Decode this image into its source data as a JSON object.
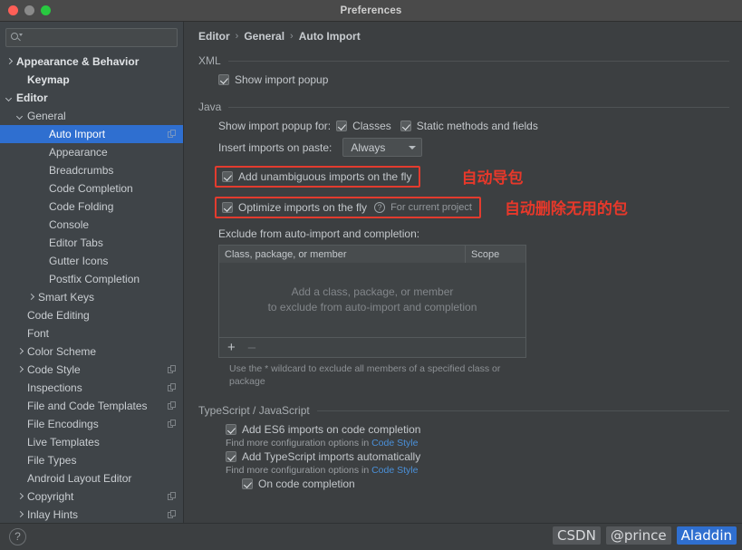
{
  "window": {
    "title": "Preferences",
    "traffic": [
      "close",
      "minimize",
      "zoom"
    ]
  },
  "sidebar": {
    "search": {
      "value": "",
      "placeholder": ""
    },
    "items": [
      {
        "label": "Appearance & Behavior",
        "indent": 0,
        "arrow": "right",
        "bold": true,
        "selected": false,
        "badge": false
      },
      {
        "label": "Keymap",
        "indent": 1,
        "arrow": "none",
        "bold": true,
        "selected": false,
        "badge": false
      },
      {
        "label": "Editor",
        "indent": 0,
        "arrow": "down",
        "bold": true,
        "selected": false,
        "badge": false
      },
      {
        "label": "General",
        "indent": 1,
        "arrow": "down",
        "bold": false,
        "selected": false,
        "badge": false
      },
      {
        "label": "Auto Import",
        "indent": 3,
        "arrow": "none",
        "bold": false,
        "selected": true,
        "badge": true
      },
      {
        "label": "Appearance",
        "indent": 3,
        "arrow": "none",
        "bold": false,
        "selected": false,
        "badge": false
      },
      {
        "label": "Breadcrumbs",
        "indent": 3,
        "arrow": "none",
        "bold": false,
        "selected": false,
        "badge": false
      },
      {
        "label": "Code Completion",
        "indent": 3,
        "arrow": "none",
        "bold": false,
        "selected": false,
        "badge": false
      },
      {
        "label": "Code Folding",
        "indent": 3,
        "arrow": "none",
        "bold": false,
        "selected": false,
        "badge": false
      },
      {
        "label": "Console",
        "indent": 3,
        "arrow": "none",
        "bold": false,
        "selected": false,
        "badge": false
      },
      {
        "label": "Editor Tabs",
        "indent": 3,
        "arrow": "none",
        "bold": false,
        "selected": false,
        "badge": false
      },
      {
        "label": "Gutter Icons",
        "indent": 3,
        "arrow": "none",
        "bold": false,
        "selected": false,
        "badge": false
      },
      {
        "label": "Postfix Completion",
        "indent": 3,
        "arrow": "none",
        "bold": false,
        "selected": false,
        "badge": false
      },
      {
        "label": "Smart Keys",
        "indent": 2,
        "arrow": "right",
        "bold": false,
        "selected": false,
        "badge": false
      },
      {
        "label": "Code Editing",
        "indent": 1,
        "arrow": "none",
        "bold": false,
        "selected": false,
        "badge": false
      },
      {
        "label": "Font",
        "indent": 1,
        "arrow": "none",
        "bold": false,
        "selected": false,
        "badge": false
      },
      {
        "label": "Color Scheme",
        "indent": 1,
        "arrow": "right",
        "bold": false,
        "selected": false,
        "badge": false
      },
      {
        "label": "Code Style",
        "indent": 1,
        "arrow": "right",
        "bold": false,
        "selected": false,
        "badge": true
      },
      {
        "label": "Inspections",
        "indent": 1,
        "arrow": "none",
        "bold": false,
        "selected": false,
        "badge": true
      },
      {
        "label": "File and Code Templates",
        "indent": 1,
        "arrow": "none",
        "bold": false,
        "selected": false,
        "badge": true
      },
      {
        "label": "File Encodings",
        "indent": 1,
        "arrow": "none",
        "bold": false,
        "selected": false,
        "badge": true
      },
      {
        "label": "Live Templates",
        "indent": 1,
        "arrow": "none",
        "bold": false,
        "selected": false,
        "badge": false
      },
      {
        "label": "File Types",
        "indent": 1,
        "arrow": "none",
        "bold": false,
        "selected": false,
        "badge": false
      },
      {
        "label": "Android Layout Editor",
        "indent": 1,
        "arrow": "none",
        "bold": false,
        "selected": false,
        "badge": false
      },
      {
        "label": "Copyright",
        "indent": 1,
        "arrow": "right",
        "bold": false,
        "selected": false,
        "badge": true
      },
      {
        "label": "Inlay Hints",
        "indent": 1,
        "arrow": "right",
        "bold": false,
        "selected": false,
        "badge": true
      }
    ]
  },
  "breadcrumb": {
    "items": [
      "Editor",
      "General",
      "Auto Import"
    ],
    "separator": "›"
  },
  "xml": {
    "title": "XML",
    "show_import_popup": {
      "label": "Show import popup",
      "checked": true
    }
  },
  "java": {
    "title": "Java",
    "show_import_popup_for_label": "Show import popup for:",
    "classes": {
      "label": "Classes",
      "checked": true
    },
    "static_methods": {
      "label": "Static methods and fields",
      "checked": true
    },
    "insert_imports_label": "Insert imports on paste:",
    "insert_imports_value": "Always",
    "add_unambiguous": {
      "label": "Add unambiguous imports on the fly",
      "checked": true,
      "highlighted": true
    },
    "optimize_imports": {
      "label": "Optimize imports on the fly",
      "checked": true,
      "highlighted": true,
      "help": "?",
      "scope": "For current project"
    },
    "exclude_label": "Exclude from auto-import and completion:",
    "table": {
      "columns": [
        "Class, package, or member",
        "Scope"
      ],
      "rows": [],
      "empty_line1": "Add a class, package, or member",
      "empty_line2": "to exclude from auto-import and completion",
      "add_button": "+",
      "remove_button": "–"
    },
    "table_hint": "Use the * wildcard to exclude all members of a specified class or package"
  },
  "typescript": {
    "title": "TypeScript / JavaScript",
    "add_es6": {
      "label": "Add ES6 imports on code completion",
      "checked": true
    },
    "find_more_1_prefix": "Find more configuration options in ",
    "find_more_1_link": "Code Style",
    "add_ts": {
      "label": "Add TypeScript imports automatically",
      "checked": true
    },
    "find_more_2_prefix": "Find more configuration options in ",
    "find_more_2_link": "Code Style",
    "on_code_completion": {
      "label": "On code completion",
      "checked": true
    }
  },
  "annotations": [
    {
      "text": "自动导包",
      "color": "#e8382a"
    },
    {
      "text": "自动删除无用的包",
      "color": "#e8382a"
    }
  ],
  "footer": {
    "help": "?",
    "watermark": {
      "part1": "CSDN",
      "part2": "@prince",
      "part3": "Aladdin"
    }
  },
  "colors": {
    "accent": "#2f6fd0",
    "annotation_red": "#e8382a",
    "link": "#4a90d9",
    "window_bg": "#3c3f41",
    "sidebar_bg": "#3f4448"
  }
}
